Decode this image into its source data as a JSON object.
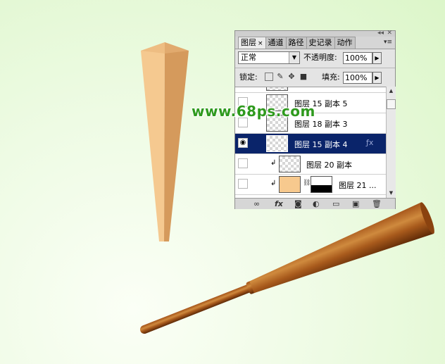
{
  "watermark": {
    "text": "www.68ps.com",
    "color": "#2f9a1e"
  },
  "layers_panel": {
    "tabs": [
      {
        "label": "图层",
        "active": true
      },
      {
        "label": "通道",
        "active": false
      },
      {
        "label": "路径",
        "active": false
      },
      {
        "label": "史记录",
        "active": false
      },
      {
        "label": "动作",
        "active": false
      }
    ],
    "tab_close_glyph": "×",
    "blend_mode": "正常",
    "opacity_label": "不透明度:",
    "opacity_value": "100%",
    "lock_label": "锁定:",
    "fill_label": "填充:",
    "fill_value": "100%",
    "layers": [
      {
        "name": "图层 15 副本 5",
        "visible": false,
        "selected": false,
        "thumb": "transparent",
        "clipped": false,
        "has_mask": false,
        "has_fx": false
      },
      {
        "name": "图层 18 副本 3",
        "visible": false,
        "selected": false,
        "thumb": "transparent",
        "clipped": false,
        "has_mask": false,
        "has_fx": false
      },
      {
        "name": "图层 15 副本 4",
        "visible": true,
        "selected": true,
        "thumb": "transparent",
        "clipped": false,
        "has_mask": false,
        "has_fx": true
      },
      {
        "name": "图层 20 副本",
        "visible": false,
        "selected": false,
        "thumb": "transparent",
        "clipped": true,
        "has_mask": false,
        "has_fx": false
      },
      {
        "name": "图层 21 ...",
        "visible": false,
        "selected": false,
        "thumb": "#f7c98e",
        "clipped": true,
        "has_mask": true,
        "has_fx": false
      }
    ],
    "bottom_icons": [
      "link-icon",
      "fx-icon",
      "mask-icon",
      "adjustment-icon",
      "folder-icon",
      "new-layer-icon",
      "trash-icon"
    ],
    "selected_color": "#0a246a"
  },
  "canvas": {
    "background_color": "#e4f8d6",
    "vertical_piece_colors": {
      "light": "#f5c990",
      "dark": "#d59a5c"
    },
    "stick_colors": {
      "light": "#b8651f",
      "dark": "#6b3008"
    }
  }
}
